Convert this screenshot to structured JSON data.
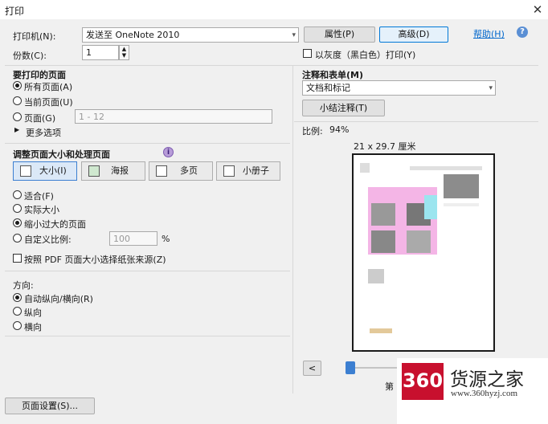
{
  "window": {
    "title": "打印"
  },
  "printer": {
    "label": "打印机(N):",
    "value": "发送至 OneNote 2010",
    "properties_label": "属性(P)",
    "advanced_label": "高级(D)",
    "help_label": "帮助(H)",
    "copies_label": "份数(C):",
    "copies_value": "1",
    "grayscale_label": "以灰度（黑白色）打印(Y)"
  },
  "pages": {
    "heading": "要打印的页面",
    "all": "所有页面(A)",
    "current": "当前页面(U)",
    "pages": "页面(G)",
    "range_placeholder": "1 - 12",
    "more": "更多选项"
  },
  "sizing": {
    "heading": "调整页面大小和处理页面",
    "tabs": [
      "大小(I)",
      "海报",
      "多页",
      "小册子"
    ],
    "fit": "适合(F)",
    "actual": "实际大小",
    "shrink": "缩小过大的页面",
    "custom": "自定义比例:",
    "custom_value": "100",
    "custom_unit": "%",
    "choose_paper": "按照 PDF 页面大小选择纸张来源(Z)"
  },
  "orientation": {
    "heading": "方向:",
    "auto": "自动纵向/横向(R)",
    "portrait": "纵向",
    "landscape": "横向"
  },
  "comments": {
    "heading": "注释和表单(M)",
    "value": "文档和标记",
    "summarize": "小结注释(T)"
  },
  "preview": {
    "scale_label": "比例:",
    "scale_value": "94%",
    "paper_size": "21 x 29.7 厘米",
    "prev": "<",
    "page_info": "第 1 页"
  },
  "footer": {
    "page_setup": "页面设置(S)..."
  },
  "watermark": {
    "number": "360",
    "text": "货源之家",
    "url": "www.360hyzj.com"
  }
}
